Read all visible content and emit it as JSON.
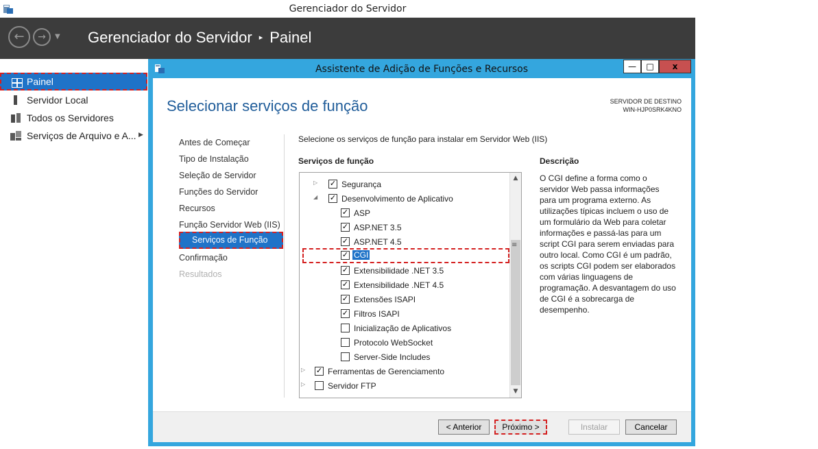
{
  "window": {
    "title": "Gerenciador do Servidor"
  },
  "header": {
    "breadcrumb_root": "Gerenciador do Servidor",
    "breadcrumb_separator": "▸",
    "breadcrumb_current": "Painel",
    "back_icon": "arrow-left-icon",
    "forward_icon": "arrow-right-icon"
  },
  "sidebar": {
    "items": [
      {
        "label": "Painel",
        "icon": "dashboard-icon",
        "active": true
      },
      {
        "label": "Servidor Local",
        "icon": "server-icon",
        "active": false
      },
      {
        "label": "Todos os Servidores",
        "icon": "servers-icon",
        "active": false
      },
      {
        "label": "Serviços de Arquivo e A...",
        "icon": "file-services-icon",
        "active": false
      }
    ]
  },
  "wizard": {
    "title": "Assistente de Adição de Funções e Recursos",
    "window_buttons": {
      "minimize": "—",
      "maximize": "□",
      "close": "x"
    },
    "heading": "Selecionar serviços de função",
    "destination_label": "SERVIDOR DE DESTINO",
    "destination_name": "WIN-HJP0SRK4KNO",
    "steps": [
      {
        "label": "Antes de Começar",
        "state": "normal"
      },
      {
        "label": "Tipo de Instalação",
        "state": "normal"
      },
      {
        "label": "Seleção de Servidor",
        "state": "normal"
      },
      {
        "label": "Funções do Servidor",
        "state": "normal"
      },
      {
        "label": "Recursos",
        "state": "normal"
      },
      {
        "label": "Função Servidor Web (IIS)",
        "state": "normal"
      },
      {
        "label": "Serviços de Função",
        "state": "current"
      },
      {
        "label": "Confirmação",
        "state": "normal"
      },
      {
        "label": "Resultados",
        "state": "disabled"
      }
    ],
    "instruction": "Selecione os serviços de função para instalar em Servidor Web (IIS)",
    "services_heading": "Serviços de função",
    "tree": [
      {
        "label": "Segurança",
        "checked": true,
        "expander": "▷",
        "level": 1
      },
      {
        "label": "Desenvolvimento de Aplicativo",
        "checked": true,
        "expander": "◢",
        "level": 1
      },
      {
        "label": "ASP",
        "checked": true,
        "expander": "",
        "level": 2
      },
      {
        "label": "ASP.NET 3.5",
        "checked": true,
        "expander": "",
        "level": 2
      },
      {
        "label": "ASP.NET 4.5",
        "checked": true,
        "expander": "",
        "level": 2
      },
      {
        "label": "CGI",
        "checked": true,
        "expander": "",
        "level": 2,
        "selected": true
      },
      {
        "label": "Extensibilidade .NET 3.5",
        "checked": true,
        "expander": "",
        "level": 2
      },
      {
        "label": "Extensibilidade .NET 4.5",
        "checked": true,
        "expander": "",
        "level": 2
      },
      {
        "label": "Extensões ISAPI",
        "checked": true,
        "expander": "",
        "level": 2
      },
      {
        "label": "Filtros ISAPI",
        "checked": true,
        "expander": "",
        "level": 2
      },
      {
        "label": "Inicialização de Aplicativos",
        "checked": false,
        "expander": "",
        "level": 2
      },
      {
        "label": "Protocolo WebSocket",
        "checked": false,
        "expander": "",
        "level": 2
      },
      {
        "label": "Server-Side Includes",
        "checked": false,
        "expander": "",
        "level": 2
      },
      {
        "label": "Ferramentas de Gerenciamento",
        "checked": true,
        "expander": "▷",
        "level": 0
      },
      {
        "label": "Servidor FTP",
        "checked": false,
        "expander": "▷",
        "level": 0
      }
    ],
    "description_heading": "Descrição",
    "description_text": "O CGI define a forma como o servidor Web passa informações para um programa externo. As utilizações típicas incluem o uso de um formulário da Web para coletar informações e passá-las para um script CGI para serem enviadas para outro local. Como CGI é um padrão, os scripts CGI podem ser elaborados com várias linguagens de programação. A desvantagem do uso de CGI é a sobrecarga de desempenho.",
    "buttons": {
      "previous": "< Anterior",
      "next": "Próximo >",
      "install": "Instalar",
      "cancel": "Cancelar"
    }
  }
}
